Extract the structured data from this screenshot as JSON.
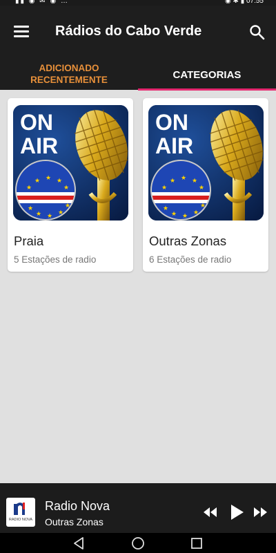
{
  "app": {
    "title": "Rádios do Cabo Verde"
  },
  "icons": {
    "menu": "menu-icon",
    "search": "search-icon",
    "rewind": "rewind-icon",
    "play": "play-icon",
    "fast_forward": "fast-forward-icon",
    "back": "nav-back-icon",
    "home": "nav-home-icon",
    "recents": "nav-recents-icon"
  },
  "tabs": [
    {
      "label": "ADICIONADO RECENTEMENTE",
      "selected": false
    },
    {
      "label": "CATEGORIAS",
      "selected": true
    }
  ],
  "colors": {
    "accent": "#e5286f",
    "tab_inactive": "#e8903a",
    "app_bar": "#1e1e1e",
    "background": "#e0e0e0"
  },
  "categories": [
    {
      "image_text_1": "ON",
      "image_text_2": "AIR",
      "name": "Praia",
      "count": "5 Estações de radio"
    },
    {
      "image_text_1": "ON",
      "image_text_2": "AIR",
      "name": "Outras Zonas",
      "count": "6 Estações de radio"
    }
  ],
  "player": {
    "station": "Radio Nova",
    "category": "Outras Zonas",
    "logo_text": "RADIO NOVA"
  }
}
